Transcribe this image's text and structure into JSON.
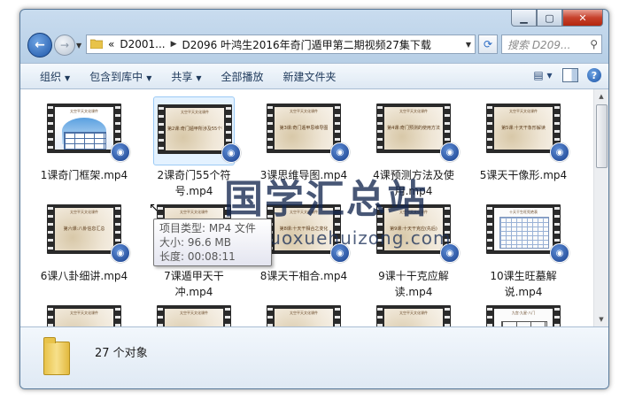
{
  "window": {
    "min_icon": "minimize-icon",
    "max_icon": "maximize-icon",
    "close_label": "✕"
  },
  "address": {
    "overflow": "«",
    "segments": [
      "D2001...",
      "D2096 叶鸿生2016年奇门遁甲第二期视频27集下载"
    ]
  },
  "search": {
    "placeholder": "搜索 D209..."
  },
  "toolbar": {
    "organize": "组织",
    "include": "包含到库中",
    "share": "共享",
    "play_all": "全部播放",
    "new_folder": "新建文件夹"
  },
  "files": [
    {
      "thumb_text": "",
      "label": "1课奇门框架.mp4"
    },
    {
      "thumb_text": "第2课:奇门遁甲所涉及55个符号",
      "label": "2课奇门55个符号.mp4"
    },
    {
      "thumb_text": "第3课:奇门遁甲思维导图",
      "label": "3课思维导图.mp4"
    },
    {
      "thumb_text": "第4课:奇门预测的使用方法",
      "label": "4课预测方法及使用.mp4"
    },
    {
      "thumb_text": "第5课:十天干象形解读",
      "label": "5课天干像形.mp4"
    },
    {
      "thumb_text": "第六课:八卦信息汇总",
      "label": "6课八卦细讲.mp4"
    },
    {
      "thumb_text": "",
      "label": "7课遁甲天干冲.mp4"
    },
    {
      "thumb_text": "第8课:十天干相合之变化",
      "label": "8课天干相合.mp4"
    },
    {
      "thumb_text": "第9课:十天干克应(先后)",
      "label": "9课十干克应解读.mp4"
    },
    {
      "thumb_text": "十天干生旺死绝表",
      "label": "10课生旺墓解说.mp4"
    },
    {
      "thumb_text": "",
      "label": ""
    },
    {
      "thumb_text": "",
      "label": ""
    },
    {
      "thumb_text": "",
      "label": ""
    },
    {
      "thumb_text": "",
      "label": ""
    },
    {
      "thumb_text": "九宫·九星·八门",
      "label": ""
    }
  ],
  "frame_header": "太空平天文化课件",
  "tooltip": {
    "type": "项目类型: MP4 文件",
    "size": "大小: 96.6 MB",
    "length": "长度: 00:08:11"
  },
  "watermark": {
    "title": "国学汇总站",
    "url": "www.guoxuehuizong.com"
  },
  "status": {
    "count": "27 个对象"
  }
}
